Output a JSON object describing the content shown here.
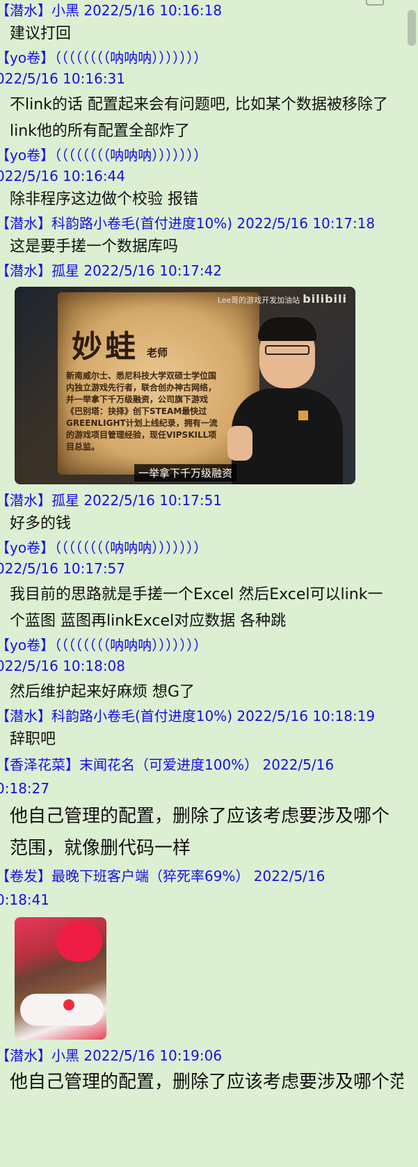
{
  "top_partial": "一 一 一",
  "messages": [
    {
      "header": "【潜水】小黑 2022/5/16 10:16:18",
      "text": "建议打回"
    },
    {
      "header": "【yo卷】（（（（（（（（呐呐呐）））））））",
      "header2": "022/5/16 10:16:31",
      "text": "不link的话 配置起来会有问题吧, 比如某个数据被移除了 link他的所有配置全部炸了"
    },
    {
      "header": "【yo卷】（（（（（（（（呐呐呐）））））））",
      "header2": "022/5/16 10:16:44",
      "text": "除非程序这边做个校验 报错"
    },
    {
      "header": "【潜水】科韵路小卷毛(首付进度10%) 2022/5/16 10:17:18",
      "text": "这是要手搓一个数据库吗"
    },
    {
      "header": "【潜水】孤星 2022/5/16 10:17:42"
    },
    {
      "header": "【潜水】孤星 2022/5/16 10:17:51",
      "text": "好多的钱"
    },
    {
      "header": "【yo卷】（（（（（（（（呐呐呐）））））））",
      "header2": "022/5/16 10:17:57",
      "text": "我目前的思路就是手搓一个Excel 然后Excel可以link一个蓝图 蓝图再linkExcel对应数据 各种跳"
    },
    {
      "header": "【yo卷】（（（（（（（（呐呐呐）））））））",
      "header2": "022/5/16 10:18:08",
      "text": "然后维护起来好麻烦 想G了"
    },
    {
      "header": "【潜水】科韵路小卷毛(首付进度10%) 2022/5/16 10:18:19",
      "text": "辞职吧"
    },
    {
      "header": "【香泽花菜】末闻花名（可爱进度100%） 2022/5/16",
      "header2": "0:18:27",
      "text": "他自己管理的配置，删除了应该考虑要涉及哪个范围，就像删代码一样"
    },
    {
      "header": "【卷发】最晚下班客户端（猝死率69%） 2022/5/16",
      "header2": "0:18:41"
    },
    {
      "header": "【潜水】小黑 2022/5/16 10:19:06",
      "text": "他自己管理的配置，删除了应该考虑要涉及哪个范围，"
    }
  ],
  "video_card": {
    "title": "妙蛙",
    "title_suffix": "老师",
    "bio": "新南威尔士、悉尼科技大学双硕士学位国内独立游戏先行者，联合创办神古网络，并一举拿下千万级融资，公司旗下游戏《巴别塔：抉择》创下STEAM最快过GREENLIGHT计划上线纪录，拥有一流的游戏项目管理经验，现任VIPSKILL项目总监。",
    "watermark": "Lee哥的游戏开发加油站",
    "watermark_logo": "bilibili",
    "caption": "一举拿下千万级融资"
  },
  "colors": {
    "background": "#dcefd2",
    "header": "#1410e6",
    "text": "#111111"
  }
}
